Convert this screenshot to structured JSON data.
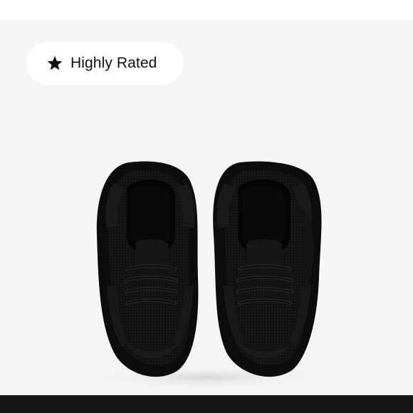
{
  "badge": {
    "label": "Highly Rated",
    "icon": "star-icon"
  },
  "product": {
    "image": "black-toddler-sneakers-top-view"
  },
  "colors": {
    "background": "#f5f5f5",
    "badge_bg": "#ffffff",
    "text": "#111111",
    "bottom_bar": "#161616"
  }
}
